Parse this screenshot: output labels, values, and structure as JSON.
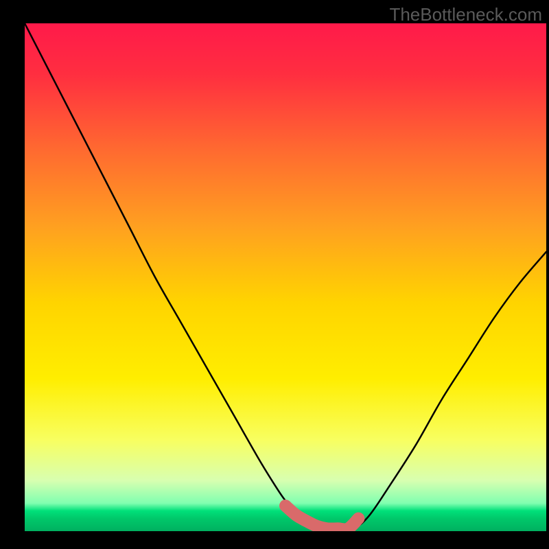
{
  "watermark": "TheBottleneck.com",
  "chart_data": {
    "type": "line",
    "title": "",
    "xlabel": "",
    "ylabel": "",
    "xlim": [
      0,
      100
    ],
    "ylim": [
      0,
      100
    ],
    "background_gradient": [
      {
        "stop": 0.0,
        "color": "#ff1a4a"
      },
      {
        "stop": 0.1,
        "color": "#ff2e40"
      },
      {
        "stop": 0.25,
        "color": "#ff6a30"
      },
      {
        "stop": 0.4,
        "color": "#ffa020"
      },
      {
        "stop": 0.55,
        "color": "#ffd400"
      },
      {
        "stop": 0.7,
        "color": "#ffee00"
      },
      {
        "stop": 0.82,
        "color": "#f8ff60"
      },
      {
        "stop": 0.9,
        "color": "#d8ffb0"
      },
      {
        "stop": 0.945,
        "color": "#80ffb0"
      },
      {
        "stop": 0.96,
        "color": "#00e07a"
      },
      {
        "stop": 0.975,
        "color": "#00c86a"
      },
      {
        "stop": 1.0,
        "color": "#00b060"
      }
    ],
    "series": [
      {
        "name": "bottleneck-curve",
        "x": [
          0,
          5,
          10,
          15,
          20,
          25,
          30,
          35,
          40,
          45,
          48,
          50,
          52,
          55,
          57,
          60,
          63,
          66,
          70,
          75,
          80,
          85,
          90,
          95,
          100
        ],
        "y": [
          100,
          90,
          80,
          70,
          60,
          50,
          41,
          32,
          23,
          14,
          9,
          6,
          4,
          2,
          0.5,
          0.5,
          0.5,
          3,
          9,
          17,
          26,
          34,
          42,
          49,
          55
        ]
      }
    ],
    "optimal_marker": {
      "name": "optimal-range",
      "color": "#d96a6a",
      "x": [
        50,
        52,
        54,
        56,
        58,
        60,
        62,
        64
      ],
      "y": [
        5.0,
        3.2,
        2.0,
        1.0,
        0.5,
        0.5,
        0.5,
        2.5
      ]
    }
  }
}
